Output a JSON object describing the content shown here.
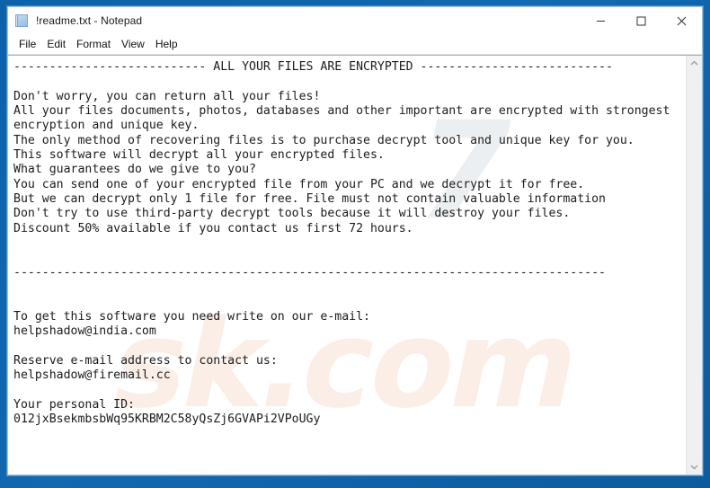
{
  "window": {
    "title": "!readme.txt - Notepad",
    "icon": "notepad-document-icon",
    "controls": {
      "minimize": "─",
      "maximize": "□",
      "close": "✕"
    }
  },
  "menubar": {
    "items": [
      {
        "label": "File"
      },
      {
        "label": "Edit"
      },
      {
        "label": "Format"
      },
      {
        "label": "View"
      },
      {
        "label": "Help"
      }
    ]
  },
  "editor": {
    "content": "--------------------------- ALL YOUR FILES ARE ENCRYPTED ---------------------------\n\nDon't worry, you can return all your files!\nAll your files documents, photos, databases and other important are encrypted with strongest\nencryption and unique key.\nThe only method of recovering files is to purchase decrypt tool and unique key for you.\nThis software will decrypt all your encrypted files.\nWhat guarantees do we give to you?\nYou can send one of your encrypted file from your PC and we decrypt it for free.\nBut we can decrypt only 1 file for free. File must not contain valuable information\nDon't try to use third-party decrypt tools because it will destroy your files.\nDiscount 50% available if you contact us first 72 hours.\n\n\n-----------------------------------------------------------------------------------\n\n\nTo get this software you need write on our e-mail:\nhelpshadow@india.com\n\nReserve e-mail address to contact us:\nhelpshadow@firemail.cc\n\nYour personal ID:\n012jxBsekmbsbWq95KRBM2C58yQsZj6GVAPi2VPoUGy",
    "lines": [
      "--------------------------- ALL YOUR FILES ARE ENCRYPTED ---------------------------",
      "",
      "Don't worry, you can return all your files!",
      "All your files documents, photos, databases and other important are encrypted with strongest",
      "encryption and unique key.",
      "The only method of recovering files is to purchase decrypt tool and unique key for you.",
      "This software will decrypt all your encrypted files.",
      "What guarantees do we give to you?",
      "You can send one of your encrypted file from your PC and we decrypt it for free.",
      "But we can decrypt only 1 file for free. File must not contain valuable information",
      "Don't try to use third-party decrypt tools because it will destroy your files.",
      "Discount 50% available if you contact us first 72 hours.",
      "",
      "",
      "-----------------------------------------------------------------------------------",
      "",
      "",
      "To get this software you need write on our e-mail:",
      "helpshadow@india.com",
      "",
      "Reserve e-mail address to contact us:",
      "helpshadow@firemail.cc",
      "",
      "Your personal ID:",
      "012jxBsekmbsbWq95KRBM2C58yQsZj6GVAPi2VPoUGy"
    ],
    "headline": "ALL YOUR FILES ARE ENCRYPTED",
    "primary_email": "helpshadow@india.com",
    "reserve_email": "helpshadow@firemail.cc",
    "personal_id": "012jxBsekmbsbWq95KRBM2C58yQsZj6GVAPi2VPoUGy",
    "discount_percent": "50%",
    "discount_window_hours": "72",
    "free_decrypt_file_count": "1"
  },
  "scrollbar": {
    "up_arrow": "⌃",
    "down_arrow": "⌄"
  },
  "watermarks": {
    "back_text": "7",
    "front_text": "sk.com"
  },
  "colors": {
    "desktop_blue": "#0f63ab",
    "window_bg": "#ffffff",
    "text": "#1c1c1c",
    "scrollbar_track": "#f0f0f0",
    "close_hover": "#e81123"
  }
}
